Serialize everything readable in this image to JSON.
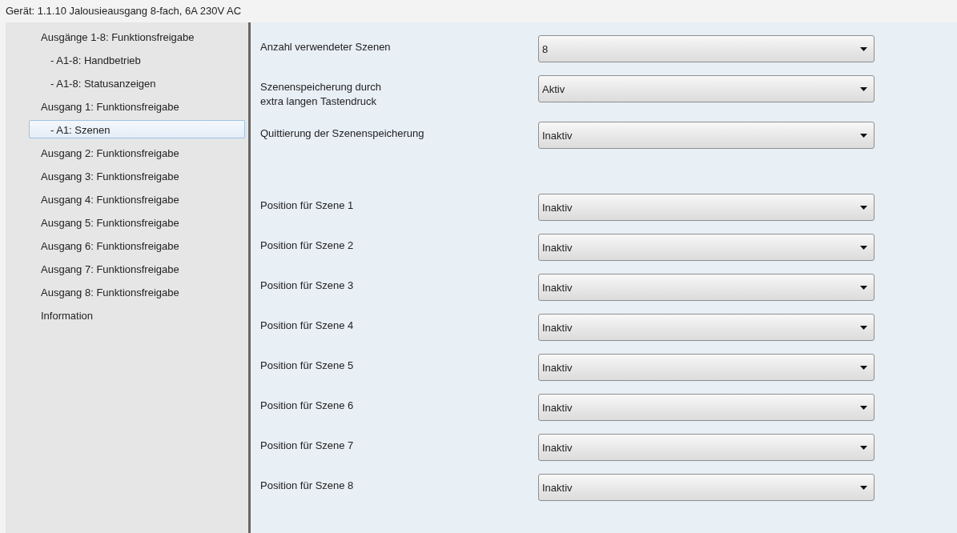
{
  "header": {
    "title": "Gerät: 1.1.10  Jalousieausgang  8-fach, 6A 230V AC"
  },
  "sidebar": {
    "items": [
      {
        "label": "Ausgänge 1-8: Funktionsfreigabe",
        "selected": false,
        "children": [
          {
            "label": "- A1-8: Handbetrieb",
            "selected": false
          },
          {
            "label": "- A1-8: Statusanzeigen",
            "selected": false
          }
        ]
      },
      {
        "label": "Ausgang 1: Funktionsfreigabe",
        "selected": false,
        "children": [
          {
            "label": "- A1: Szenen",
            "selected": true
          }
        ]
      },
      {
        "label": "Ausgang 2: Funktionsfreigabe",
        "selected": false
      },
      {
        "label": "Ausgang 3: Funktionsfreigabe",
        "selected": false
      },
      {
        "label": "Ausgang 4: Funktionsfreigabe",
        "selected": false
      },
      {
        "label": "Ausgang 5: Funktionsfreigabe",
        "selected": false
      },
      {
        "label": "Ausgang 6: Funktionsfreigabe",
        "selected": false
      },
      {
        "label": "Ausgang 7: Funktionsfreigabe",
        "selected": false
      },
      {
        "label": "Ausgang 8: Funktionsfreigabe",
        "selected": false
      },
      {
        "label": "Information",
        "selected": false
      }
    ]
  },
  "settings": [
    {
      "label": "Anzahl verwendeter Szenen",
      "value": "8"
    },
    {
      "label": "Szenenspeicherung durch\nextra langen Tastendruck",
      "value": "Aktiv"
    },
    {
      "label": "Quittierung der Szenenspeicherung",
      "value": "Inaktiv"
    }
  ],
  "scene_positions": [
    {
      "label": "Position für Szene 1",
      "value": "Inaktiv"
    },
    {
      "label": "Position für Szene 2",
      "value": "Inaktiv"
    },
    {
      "label": "Position für Szene 3",
      "value": "Inaktiv"
    },
    {
      "label": "Position für Szene 4",
      "value": "Inaktiv"
    },
    {
      "label": "Position für Szene 5",
      "value": "Inaktiv"
    },
    {
      "label": "Position für Szene 6",
      "value": "Inaktiv"
    },
    {
      "label": "Position für Szene 7",
      "value": "Inaktiv"
    },
    {
      "label": "Position für Szene 8",
      "value": "Inaktiv"
    }
  ]
}
